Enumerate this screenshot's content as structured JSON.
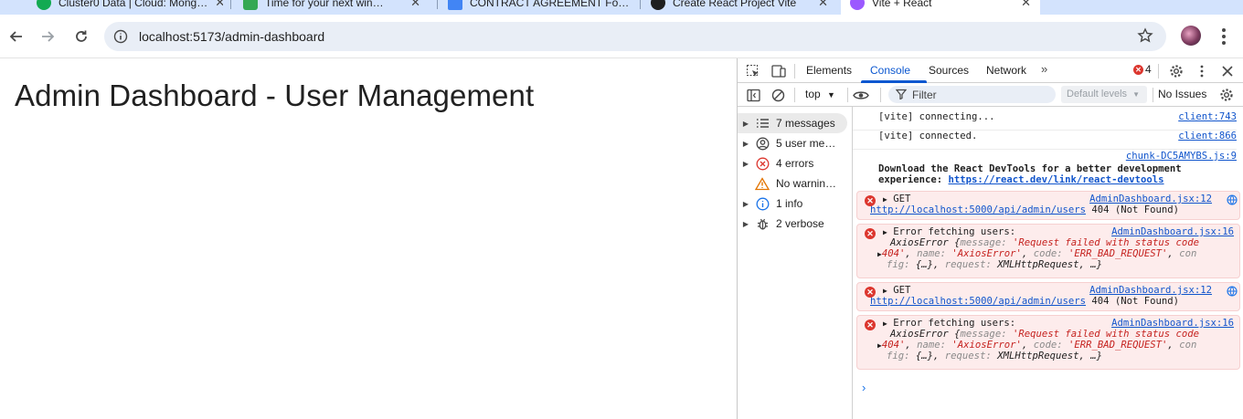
{
  "browser": {
    "tabs": [
      {
        "title": "Cluster0 Data | Cloud: Mong…",
        "icon": "mongodb-leaf-icon",
        "color": "#13aa52"
      },
      {
        "title": "Time for your next win…",
        "icon": "app-icon",
        "color": "#34a853"
      },
      {
        "title": "CONTRACT AGREEMENT Fo…",
        "icon": "google-docs-icon",
        "color": "#4285f4"
      },
      {
        "title": "Create React Project Vite",
        "icon": "github-icon",
        "color": "#1f1f1f"
      },
      {
        "title": "Vite + React",
        "icon": "vite-icon",
        "color": "#9b59ff"
      }
    ],
    "url": "localhost:5173/admin-dashboard"
  },
  "page": {
    "heading": "Admin Dashboard - User Management"
  },
  "devtools": {
    "tabs": [
      "Elements",
      "Console",
      "Sources",
      "Network"
    ],
    "active_tab": "Console",
    "error_badge": "4",
    "context": "top",
    "filter_placeholder": "Filter",
    "levels_label": "Default levels",
    "issues_label": "No Issues",
    "sidebar": [
      {
        "label": "7 messages",
        "icon": "list-icon",
        "selected": true
      },
      {
        "label": "5 user me…",
        "icon": "user-icon",
        "selected": false
      },
      {
        "label": "4 errors",
        "icon": "error-icon",
        "selected": false
      },
      {
        "label": "No warnin…",
        "icon": "warning-icon",
        "selected": false
      },
      {
        "label": "1 info",
        "icon": "info-icon",
        "selected": false
      },
      {
        "label": "2 verbose",
        "icon": "bug-icon",
        "selected": false
      }
    ],
    "console": {
      "vite_connecting": "[vite] connecting...",
      "vite_connecting_src": "client:743",
      "vite_connected": "[vite] connected.",
      "vite_connected_src": "client:866",
      "devtools_src": "chunk-DC5AMYBS.js:9",
      "devtools_line1": "Download the React DevTools for a better development",
      "devtools_line2_prefix": "experience: ",
      "devtools_link": "https://react.dev/link/react-devtools",
      "get_label": "GET",
      "get_src": "AdminDashboard.jsx:12",
      "get_url": "http://localhost:5000/api/admin/users",
      "get_status": "404 (Not Found)",
      "fetch_error": "Error fetching users:",
      "fetch_src": "AdminDashboard.jsx:16",
      "axios_name": "AxiosError",
      "axios_line1_key": "message",
      "axios_line1_val": "'Request failed with status code",
      "axios_line2_val": "404'",
      "axios_line2_name_key": "name",
      "axios_line2_name_val": "'AxiosError'",
      "axios_line2_code_key": "code",
      "axios_line2_code_val": "'ERR_BAD_REQUEST'",
      "axios_line2_tail": "con",
      "axios_line3_head": "fig",
      "axios_line3_rest": "{…}, ",
      "axios_line3_req_key": "request",
      "axios_line3_req_val": "XMLHttpRequest, …}"
    }
  }
}
